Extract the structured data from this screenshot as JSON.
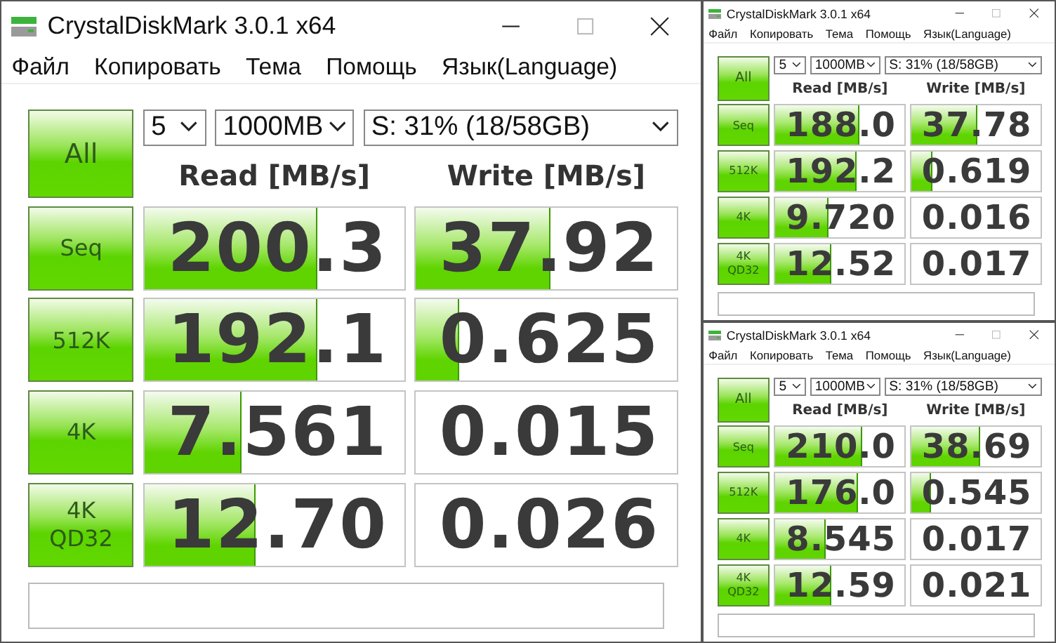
{
  "windows": [
    {
      "title": "CrystalDiskMark 3.0.1 x64",
      "menu": [
        "Файл",
        "Копировать",
        "Тема",
        "Помощь",
        "Язык(Language)"
      ],
      "all_button": "All",
      "count": "5",
      "size": "1000MB",
      "drive": "S: 31% (18/58GB)",
      "headers": [
        "Read [MB/s]",
        "Write [MB/s]"
      ],
      "rows": [
        {
          "label": "Seq",
          "read": {
            "value": "200.3",
            "level": 0.66
          },
          "write": {
            "value": "37.92",
            "level": 0.51
          }
        },
        {
          "label": "512K",
          "read": {
            "value": "192.1",
            "level": 0.66
          },
          "write": {
            "value": "0.625",
            "level": 0.16
          }
        },
        {
          "label": "4K",
          "read": {
            "value": "7.561",
            "level": 0.37
          },
          "write": {
            "value": "0.015"
          }
        },
        {
          "label": "4K\nQD32",
          "read": {
            "value": "12.70",
            "level": 0.42
          },
          "write": {
            "value": "0.026"
          }
        }
      ]
    },
    {
      "title": "CrystalDiskMark 3.0.1 x64",
      "menu": [
        "Файл",
        "Копировать",
        "Тема",
        "Помощь",
        "Язык(Language)"
      ],
      "all_button": "All",
      "count": "5",
      "size": "1000MB",
      "drive": "S: 31% (18/58GB)",
      "headers": [
        "Read [MB/s]",
        "Write [MB/s]"
      ],
      "rows": [
        {
          "label": "Seq",
          "read": {
            "value": "188.0",
            "level": 0.64
          },
          "write": {
            "value": "37.78",
            "level": 0.5
          }
        },
        {
          "label": "512K",
          "read": {
            "value": "192.2",
            "level": 0.62
          },
          "write": {
            "value": "0.619",
            "level": 0.15
          }
        },
        {
          "label": "4K",
          "read": {
            "value": "9.720",
            "level": 0.4
          },
          "write": {
            "value": "0.016"
          }
        },
        {
          "label": "4K\nQD32",
          "read": {
            "value": "12.52",
            "level": 0.42
          },
          "write": {
            "value": "0.017"
          }
        }
      ]
    },
    {
      "title": "CrystalDiskMark 3.0.1 x64",
      "menu": [
        "Файл",
        "Копировать",
        "Тема",
        "Помощь",
        "Язык(Language)"
      ],
      "all_button": "All",
      "count": "5",
      "size": "1000MB",
      "drive": "S: 31% (18/58GB)",
      "headers": [
        "Read [MB/s]",
        "Write [MB/s]"
      ],
      "rows": [
        {
          "label": "Seq",
          "read": {
            "value": "210.0",
            "level": 0.66
          },
          "write": {
            "value": "38.69",
            "level": 0.52
          }
        },
        {
          "label": "512K",
          "read": {
            "value": "176.0",
            "level": 0.63
          },
          "write": {
            "value": "0.545",
            "level": 0.14
          }
        },
        {
          "label": "4K",
          "read": {
            "value": "8.545",
            "level": 0.38
          },
          "write": {
            "value": "0.017"
          }
        },
        {
          "label": "4K\nQD32",
          "read": {
            "value": "12.59",
            "level": 0.42
          },
          "write": {
            "value": "0.021"
          }
        }
      ]
    }
  ]
}
